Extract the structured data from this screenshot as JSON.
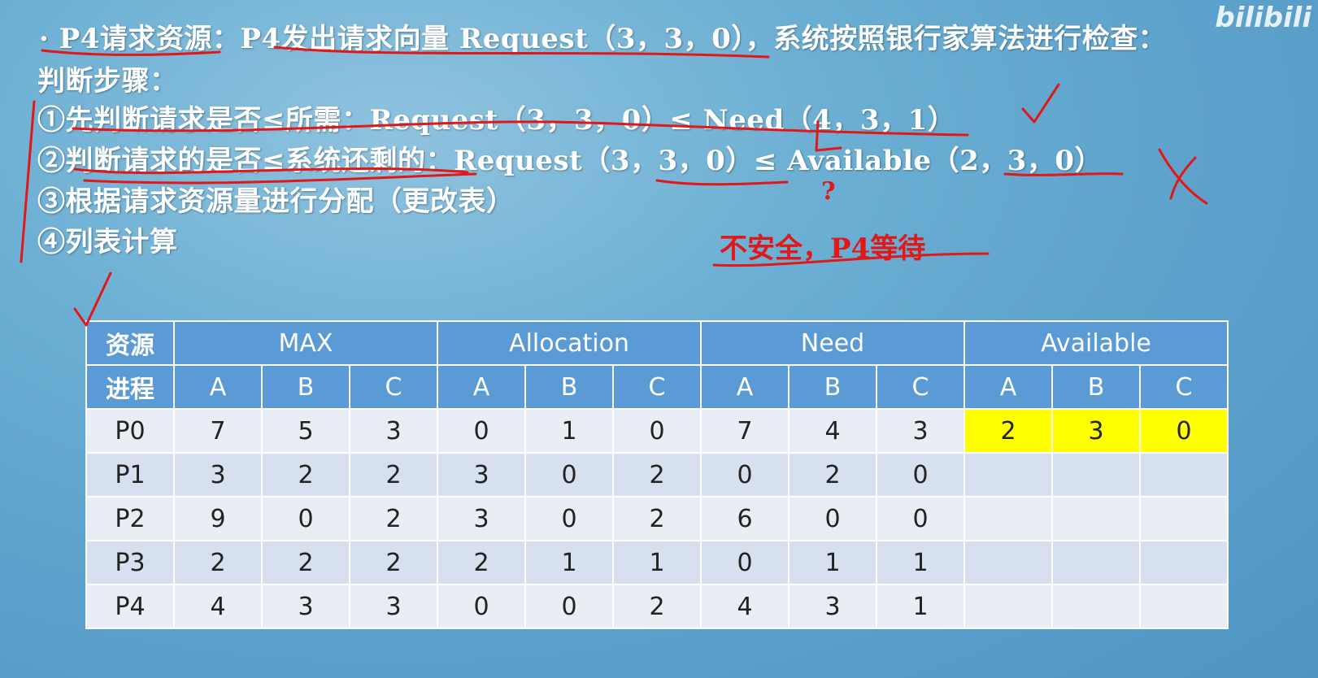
{
  "slide": {
    "title": "· P4请求资源：P4发出请求向量 Request（3，3，0），系统按照银行家算法进行检查：",
    "steps_heading": "判断步骤：",
    "steps": [
      "①先判断请求是否≤所需：Request（3，3，0）≤ Need（4，3，1）",
      "②判断请求的是否≤系统还剩的：Request（3，3，0）≤ Available（2，3，0）",
      "③根据请求资源量进行分配（更改表）",
      "④列表计算"
    ],
    "annotation_conclusion": "不安全，P4等待",
    "annotation_question": "?",
    "watermark": "bilibili"
  },
  "table": {
    "corner_top": "资源",
    "corner_bottom": "进程",
    "groups": [
      "MAX",
      "Allocation",
      "Need",
      "Available"
    ],
    "sub_headers": [
      "A",
      "B",
      "C",
      "A",
      "B",
      "C",
      "A",
      "B",
      "C",
      "A",
      "B",
      "C"
    ],
    "rows": [
      {
        "process": "P0",
        "values": [
          "7",
          "5",
          "3",
          "0",
          "1",
          "0",
          "7",
          "4",
          "3",
          "2",
          "3",
          "0"
        ]
      },
      {
        "process": "P1",
        "values": [
          "3",
          "2",
          "2",
          "3",
          "0",
          "2",
          "0",
          "2",
          "0",
          "",
          "",
          ""
        ]
      },
      {
        "process": "P2",
        "values": [
          "9",
          "0",
          "2",
          "3",
          "0",
          "2",
          "6",
          "0",
          "0",
          "",
          "",
          ""
        ]
      },
      {
        "process": "P3",
        "values": [
          "2",
          "2",
          "2",
          "2",
          "1",
          "1",
          "0",
          "1",
          "1",
          "",
          "",
          ""
        ]
      },
      {
        "process": "P4",
        "values": [
          "4",
          "3",
          "3",
          "0",
          "0",
          "2",
          "4",
          "3",
          "1",
          "",
          "",
          ""
        ]
      }
    ],
    "highlight_color": "#ffff00",
    "header_color": "#5b9bd5"
  }
}
